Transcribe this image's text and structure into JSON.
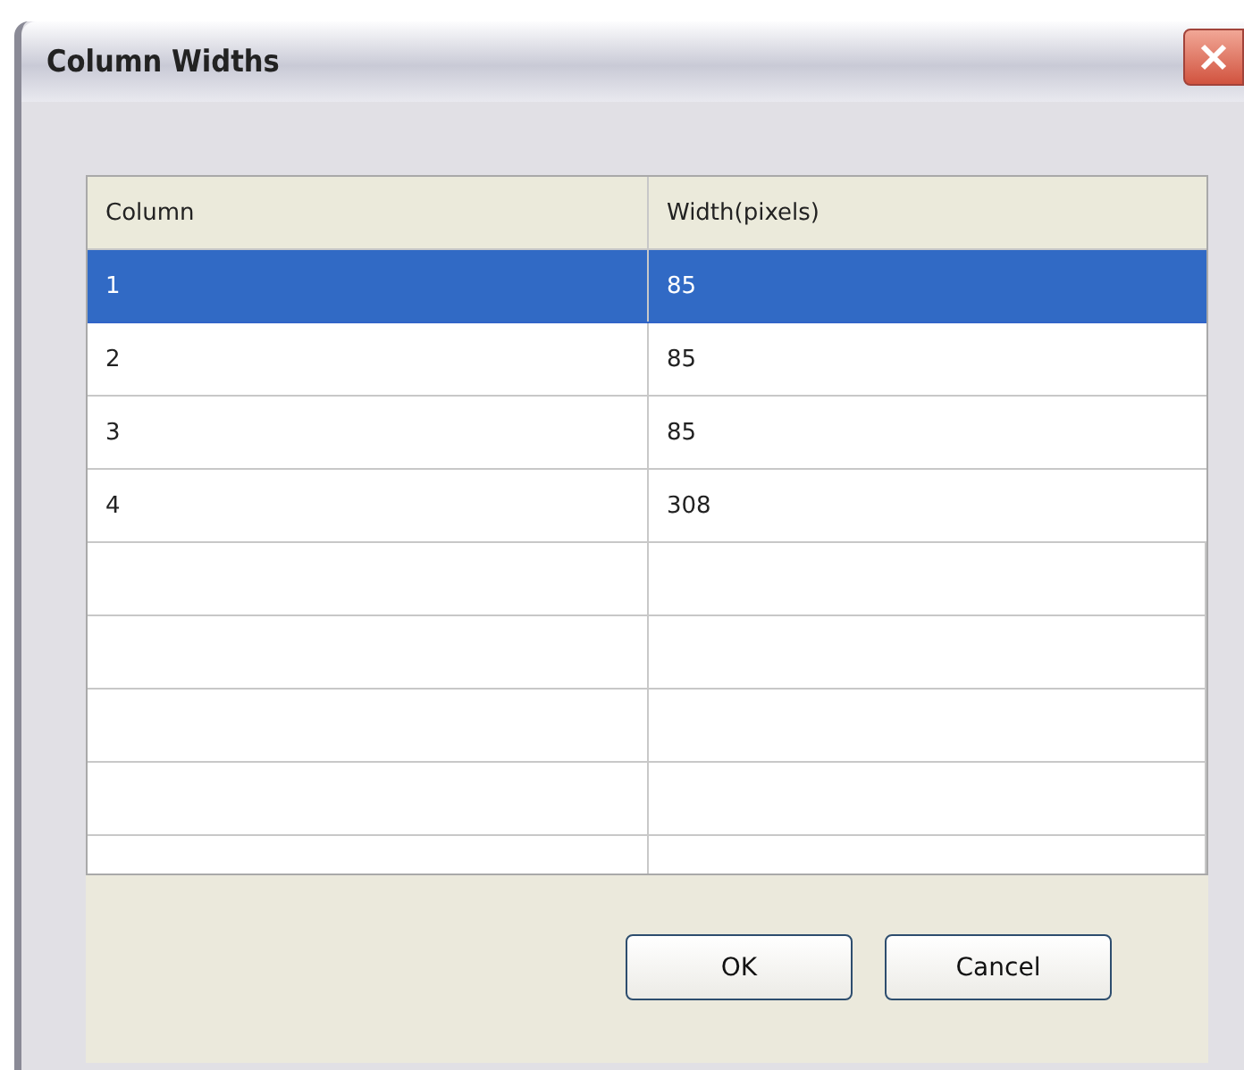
{
  "window": {
    "title": "Column Widths"
  },
  "table": {
    "columns": [
      "Column",
      "Width(pixels)"
    ],
    "rows": [
      {
        "cells": [
          "1",
          "85"
        ],
        "selected": true
      },
      {
        "cells": [
          "2",
          "85"
        ],
        "selected": false
      },
      {
        "cells": [
          "3",
          "85"
        ],
        "selected": false
      },
      {
        "cells": [
          "4",
          "308"
        ],
        "selected": false
      }
    ]
  },
  "buttons": [
    "OK",
    "Cancel"
  ]
}
